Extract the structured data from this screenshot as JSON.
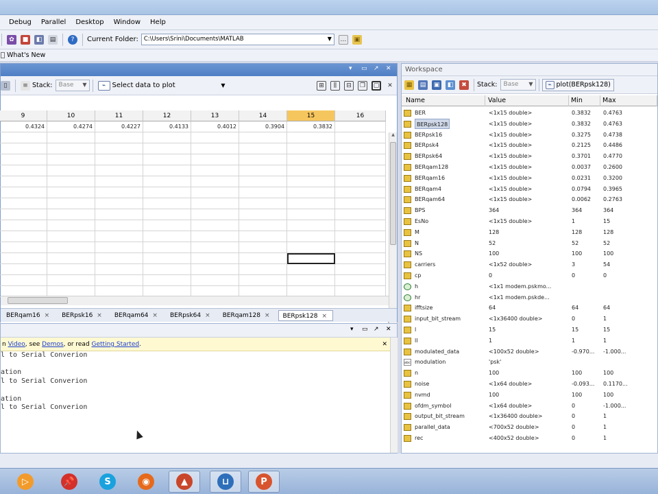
{
  "menu": [
    "Debug",
    "Parallel",
    "Desktop",
    "Window",
    "Help"
  ],
  "toolbar": {
    "folder_label": "Current Folder:",
    "folder_path": "C:\\Users\\Srini\\Documents\\MATLAB"
  },
  "shortcuts": {
    "whats_new": "What's New"
  },
  "variable_editor": {
    "stack_label": "Stack:",
    "stack_value": "Base",
    "select_data": "Select data to plot",
    "columns": [
      "9",
      "10",
      "11",
      "12",
      "13",
      "14",
      "15",
      "16"
    ],
    "selected_column": "15",
    "row1": [
      "0.4324",
      "0.4274",
      "0.4227",
      "0.4133",
      "0.4012",
      "0.3904",
      "0.3832",
      ""
    ],
    "tabs": [
      "BERqam16",
      "BERpsk16",
      "BERqam64",
      "BERpsk64",
      "BERqam128",
      "BERpsk128"
    ],
    "active_tab": "BERpsk128"
  },
  "command_window": {
    "info_prefix": "n ",
    "info_video": "Video",
    "info_mid1": ", see ",
    "info_demos": "Demos",
    "info_mid2": ", or read ",
    "info_getting_started": "Getting Started",
    "info_end": ".",
    "lines": [
      "l to Serial Converion",
      "",
      "ation",
      "l to Serial Converion",
      "",
      "ation",
      "l to Serial Converion"
    ]
  },
  "workspace": {
    "title": "Workspace",
    "stack_label": "Stack:",
    "stack_value": "Base",
    "plot_label": "plot(BERpsk128)",
    "headers": {
      "name": "Name",
      "value": "Value",
      "min": "Min",
      "max": "Max"
    },
    "selected_row": "BERpsk128",
    "rows": [
      {
        "name": "BER",
        "value": "<1x15 double>",
        "min": "0.3832",
        "max": "0.4763",
        "type": "num"
      },
      {
        "name": "BERpsk128",
        "value": "<1x15 double>",
        "min": "0.3832",
        "max": "0.4763",
        "type": "num"
      },
      {
        "name": "BERpsk16",
        "value": "<1x15 double>",
        "min": "0.3275",
        "max": "0.4738",
        "type": "num"
      },
      {
        "name": "BERpsk4",
        "value": "<1x15 double>",
        "min": "0.2125",
        "max": "0.4486",
        "type": "num"
      },
      {
        "name": "BERpsk64",
        "value": "<1x15 double>",
        "min": "0.3701",
        "max": "0.4770",
        "type": "num"
      },
      {
        "name": "BERqam128",
        "value": "<1x15 double>",
        "min": "0.0037",
        "max": "0.2600",
        "type": "num"
      },
      {
        "name": "BERqam16",
        "value": "<1x15 double>",
        "min": "0.0231",
        "max": "0.3200",
        "type": "num"
      },
      {
        "name": "BERqam4",
        "value": "<1x15 double>",
        "min": "0.0794",
        "max": "0.3965",
        "type": "num"
      },
      {
        "name": "BERqam64",
        "value": "<1x15 double>",
        "min": "0.0062",
        "max": "0.2763",
        "type": "num"
      },
      {
        "name": "BPS",
        "value": "364",
        "min": "364",
        "max": "364",
        "type": "num"
      },
      {
        "name": "EsNo",
        "value": "<1x15 double>",
        "min": "1",
        "max": "15",
        "type": "num"
      },
      {
        "name": "M",
        "value": "128",
        "min": "128",
        "max": "128",
        "type": "num"
      },
      {
        "name": "N",
        "value": "52",
        "min": "52",
        "max": "52",
        "type": "num"
      },
      {
        "name": "NS",
        "value": "100",
        "min": "100",
        "max": "100",
        "type": "num"
      },
      {
        "name": "carriers",
        "value": "<1x52 double>",
        "min": "3",
        "max": "54",
        "type": "num"
      },
      {
        "name": "cp",
        "value": "0",
        "min": "0",
        "max": "0",
        "type": "num"
      },
      {
        "name": "h",
        "value": "<1x1 modem.pskmo...",
        "min": "",
        "max": "",
        "type": "obj"
      },
      {
        "name": "hr",
        "value": "<1x1 modem.pskde...",
        "min": "",
        "max": "",
        "type": "obj"
      },
      {
        "name": "ifftsize",
        "value": "64",
        "min": "64",
        "max": "64",
        "type": "num"
      },
      {
        "name": "input_bit_stream",
        "value": "<1x36400 double>",
        "min": "0",
        "max": "1",
        "type": "num"
      },
      {
        "name": "l",
        "value": "15",
        "min": "15",
        "max": "15",
        "type": "num"
      },
      {
        "name": "ll",
        "value": "1",
        "min": "1",
        "max": "1",
        "type": "num"
      },
      {
        "name": "modulated_data",
        "value": "<100x52 double>",
        "min": "-0.970...",
        "max": "-1.000...",
        "type": "num"
      },
      {
        "name": "modulation",
        "value": "'psk'",
        "min": "",
        "max": "",
        "type": "chr"
      },
      {
        "name": "n",
        "value": "100",
        "min": "100",
        "max": "100",
        "type": "num"
      },
      {
        "name": "noise",
        "value": "<1x64 double>",
        "min": "-0.093...",
        "max": "0.1170...",
        "type": "num"
      },
      {
        "name": "nvmd",
        "value": "100",
        "min": "100",
        "max": "100",
        "type": "num"
      },
      {
        "name": "ofdm_symbol",
        "value": "<1x64 double>",
        "min": "0",
        "max": "-1.000...",
        "type": "num"
      },
      {
        "name": "output_bit_stream",
        "value": "<1x36400 double>",
        "min": "0",
        "max": "1",
        "type": "num"
      },
      {
        "name": "parallel_data",
        "value": "<700x52 double>",
        "min": "0",
        "max": "1",
        "type": "num"
      },
      {
        "name": "rec",
        "value": "<400x52 double>",
        "min": "0",
        "max": "1",
        "type": "num"
      }
    ]
  },
  "taskbar": [
    "media-player-icon",
    "pin-app-icon",
    "skype-icon",
    "firefox-icon",
    "matlab-icon",
    "editor-icon",
    "powerpoint-icon"
  ]
}
